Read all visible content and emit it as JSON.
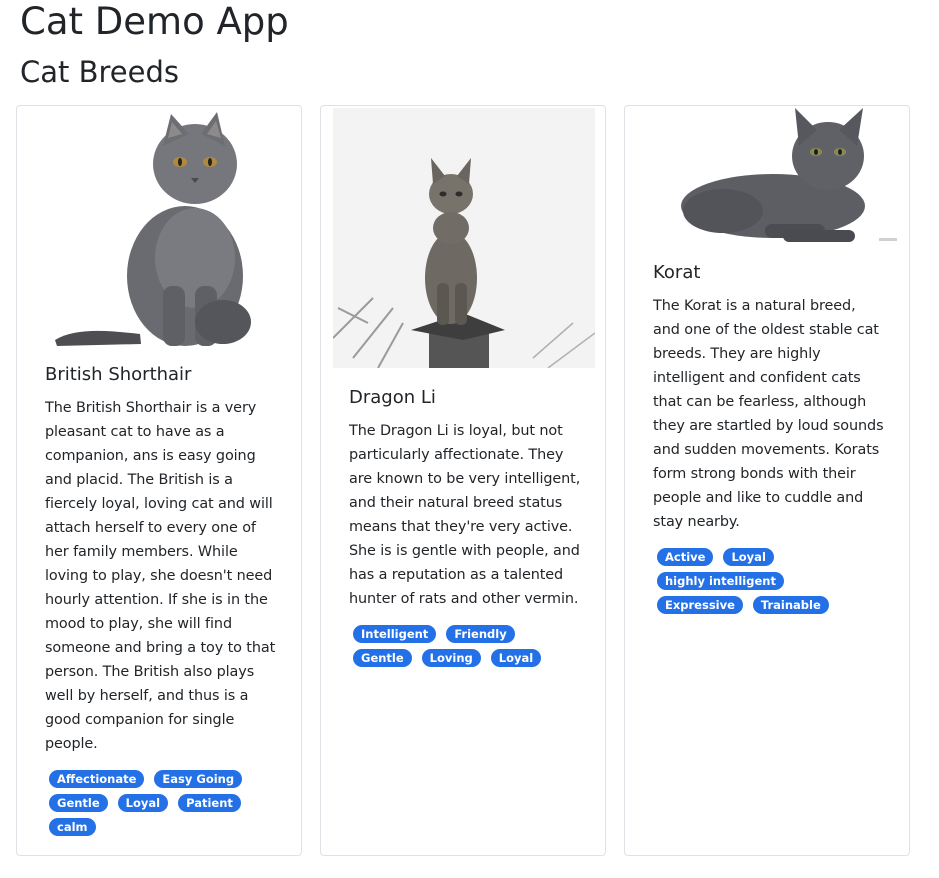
{
  "app": {
    "title": "Cat Demo App",
    "section_title": "Cat Breeds"
  },
  "colors": {
    "badge": "#2470e6",
    "card_border": "#dee2e6",
    "text": "#212529"
  },
  "cards": [
    {
      "title": "British Shorthair",
      "image_icon": "british-shorthair-cat-photo",
      "description": "The British Shorthair is a very pleasant cat to have as a companion, ans is easy going and placid. The British is a fiercely loyal, loving cat and will attach herself to every one of her family members. While loving to play, she doesn't need hourly attention. If she is in the mood to play, she will find someone and bring a toy to that person. The British also plays well by herself, and thus is a good companion for single people.",
      "tags": [
        "Affectionate",
        "Easy Going",
        "Gentle",
        "Loyal",
        "Patient",
        "calm"
      ]
    },
    {
      "title": "Dragon Li",
      "image_icon": "dragon-li-cat-photo",
      "description": "The Dragon Li is loyal, but not particularly affectionate. They are known to be very intelligent, and their natural breed status means that they're very active. She is is gentle with people, and has a reputation as a talented hunter of rats and other vermin.",
      "tags": [
        "Intelligent",
        "Friendly",
        "Gentle",
        "Loving",
        "Loyal"
      ]
    },
    {
      "title": "Korat",
      "image_icon": "korat-cat-photo",
      "description": "The Korat is a natural breed, and one of the oldest stable cat breeds. They are highly intelligent and confident cats that can be fearless, although they are startled by loud sounds and sudden movements. Korats form strong bonds with their people and like to cuddle and stay nearby.",
      "tags": [
        "Active",
        "Loyal",
        "highly intelligent",
        "Expressive",
        "Trainable"
      ]
    }
  ]
}
